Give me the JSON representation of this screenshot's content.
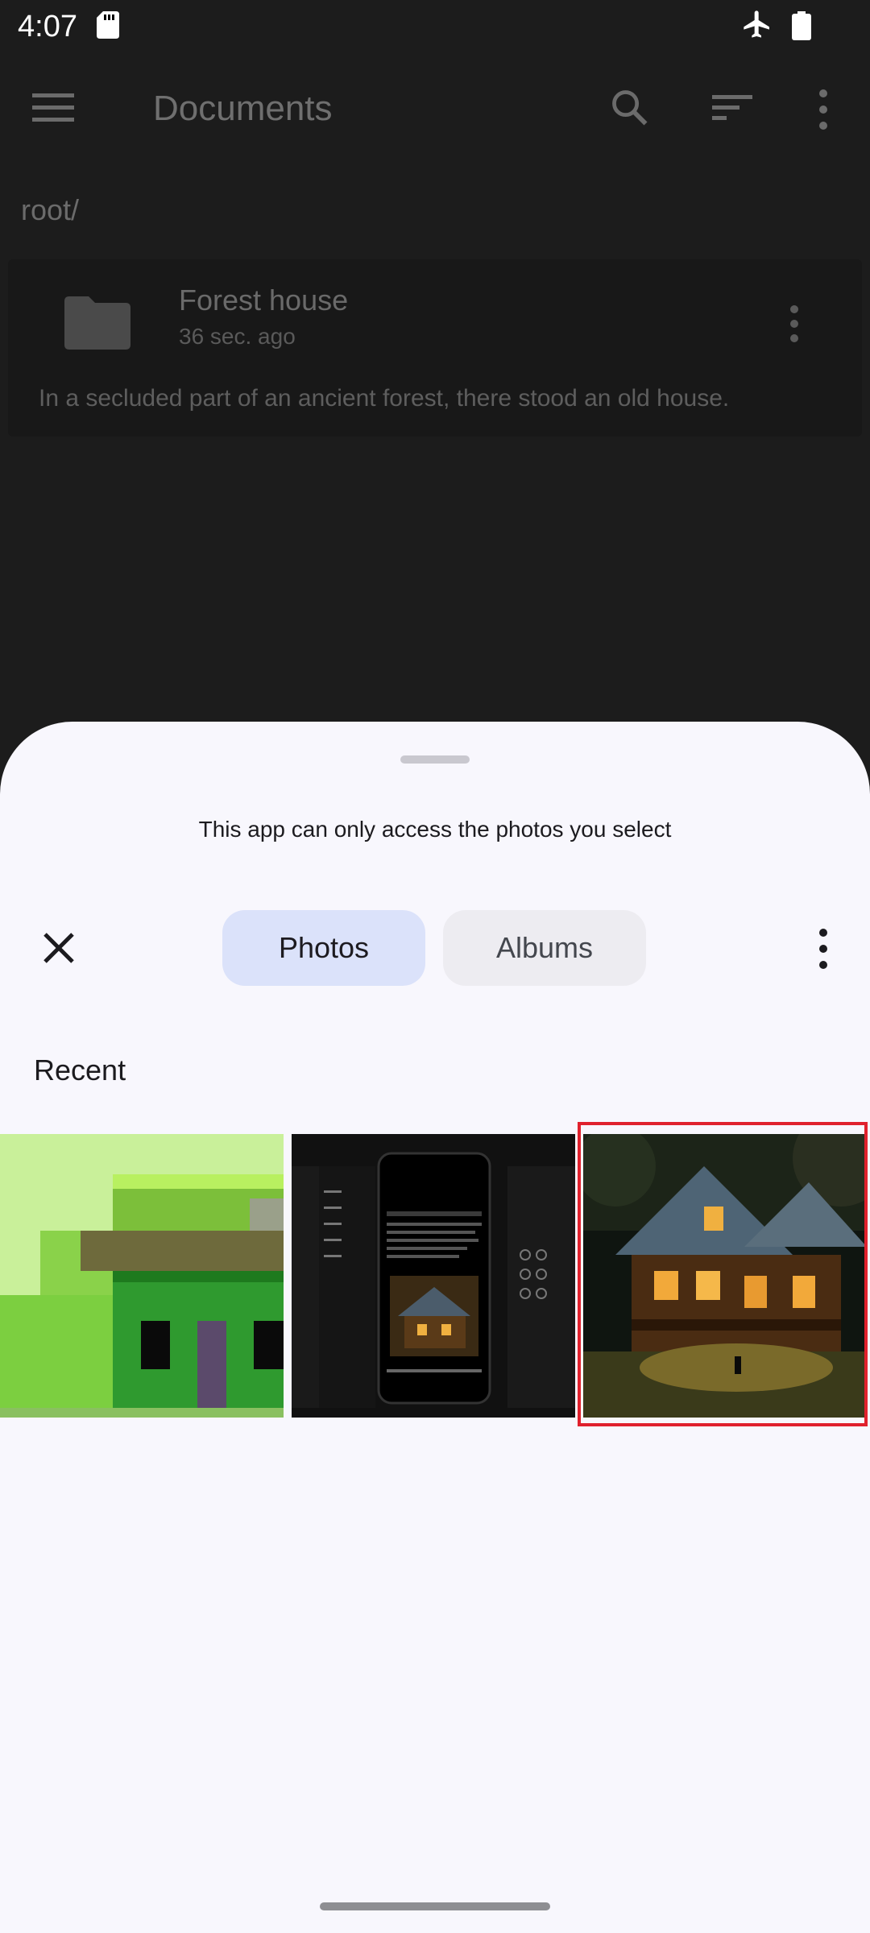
{
  "status_bar": {
    "time": "4:07",
    "icons": [
      "sd-card-icon",
      "airplane-mode-icon",
      "battery-icon"
    ]
  },
  "app_bar": {
    "title": "Documents",
    "icons": [
      "menu-icon",
      "search-icon",
      "sort-icon",
      "more-vert-icon"
    ]
  },
  "breadcrumb": "root/",
  "documents": [
    {
      "name": "Forest house",
      "modified": "36 sec. ago",
      "preview": "In a secluded part of an ancient forest, there stood an old house."
    }
  ],
  "photo_picker": {
    "notice": "This app can only access the photos you select",
    "tabs": [
      {
        "label": "Photos",
        "selected": true
      },
      {
        "label": "Albums",
        "selected": false
      }
    ],
    "section_title": "Recent",
    "selected_index": 2,
    "colors": {
      "sheet_bg": "#f8f7fd",
      "tab_selected": "#dbe2fa",
      "tab_unselected": "#edecf1",
      "selection_border": "#e0212d"
    }
  }
}
